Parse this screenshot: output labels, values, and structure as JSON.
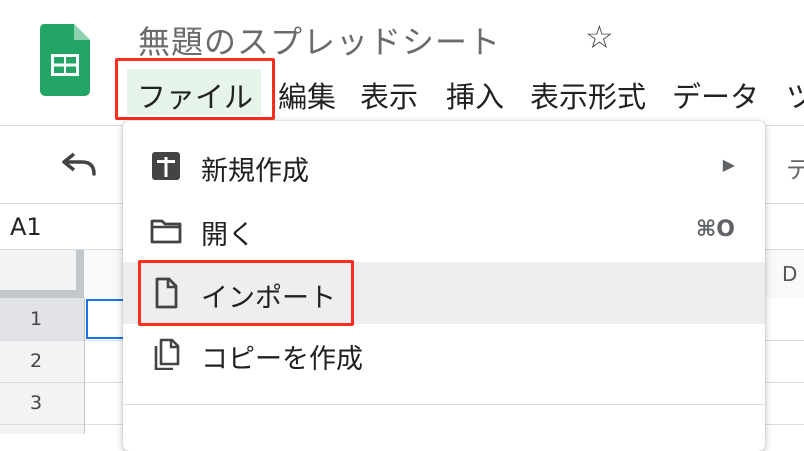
{
  "app": {
    "doc_title": "無題のスプレッドシート",
    "star_glyph": "☆"
  },
  "menubar": {
    "items": [
      {
        "label": "ファイル"
      },
      {
        "label": "編集"
      },
      {
        "label": "表示"
      },
      {
        "label": "挿入"
      },
      {
        "label": "表示形式"
      },
      {
        "label": "データ"
      },
      {
        "label": "ツ"
      }
    ]
  },
  "toolbar": {
    "undo_icon": "undo-icon",
    "partial_right": "テ"
  },
  "formula_bar": {
    "cell_ref": "A1"
  },
  "sheet": {
    "row_numbers": [
      "1",
      "2",
      "3"
    ],
    "column_partial": "D"
  },
  "file_menu": {
    "items": [
      {
        "label": "新規作成",
        "icon": "new-icon",
        "right": "▶"
      },
      {
        "label": "開く",
        "icon": "folder-icon",
        "right": "⌘O"
      },
      {
        "label": "インポート",
        "icon": "file-icon",
        "right": ""
      },
      {
        "label": "コピーを作成",
        "icon": "copy-icon",
        "right": ""
      }
    ]
  },
  "colors": {
    "brand_green": "#0f9d58",
    "highlight_red": "#ff2d20",
    "active_menu_bg": "#e6f4ea"
  }
}
